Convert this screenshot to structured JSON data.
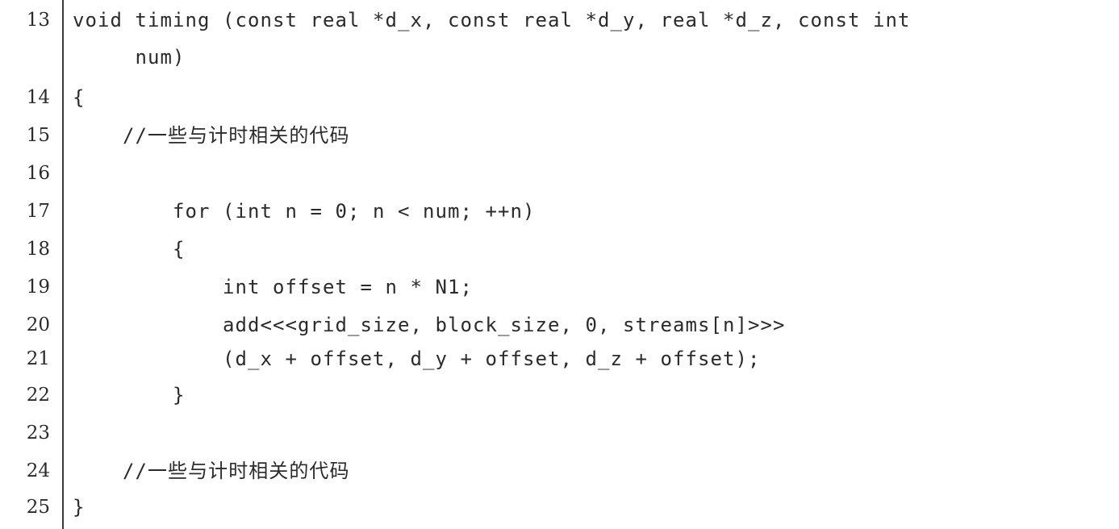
{
  "listing": {
    "lines": [
      {
        "number": "13",
        "text": "void timing (const real *d_x, const real *d_y, real *d_z, const int"
      },
      {
        "number": "",
        "text": "     num)"
      },
      {
        "number": "14",
        "text": "{"
      },
      {
        "number": "15",
        "text": "    //一些与计时相关的代码"
      },
      {
        "number": "16",
        "text": ""
      },
      {
        "number": "17",
        "text": "        for (int n = 0; n < num; ++n)"
      },
      {
        "number": "18",
        "text": "        {"
      },
      {
        "number": "19",
        "text": "            int offset = n * N1;"
      },
      {
        "number": "20",
        "text": "            add<<<grid_size, block_size, 0, streams[n]>>>"
      },
      {
        "number": "21",
        "text": "            (d_x + offset, d_y + offset, d_z + offset);"
      },
      {
        "number": "22",
        "text": "        }"
      },
      {
        "number": "23",
        "text": ""
      },
      {
        "number": "24",
        "text": "    //一些与计时相关的代码"
      },
      {
        "number": "25",
        "text": "}"
      }
    ]
  }
}
